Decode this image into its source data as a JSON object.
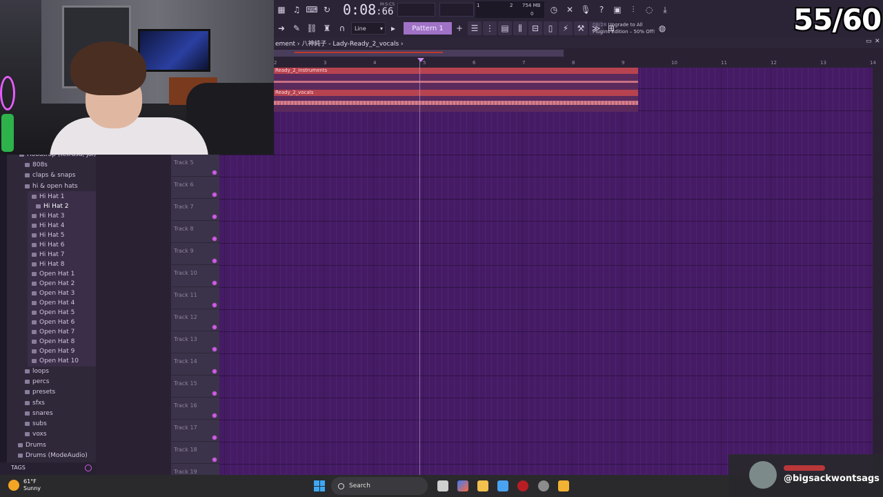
{
  "counter": "55/60",
  "toolbar": {
    "time": "0:08",
    "time_small": "66",
    "time_unit": "M:S:CS",
    "cpu_a": "1",
    "cpu_b": "2",
    "mem": "754 MB",
    "cpu_c": "0",
    "line_mode": "Line",
    "pattern": "Pattern 1",
    "upgrade_counter": "08/28",
    "upgrade_line1": "Upgrade to All",
    "upgrade_line2": "Plugins Edition – 50% Off!"
  },
  "playlist": {
    "title": "ement › 八神純子 - Lady-Ready_2_vocals ›",
    "ruler": [
      "2",
      "3",
      "4",
      "5",
      "6",
      "7",
      "8",
      "9",
      "10",
      "11",
      "12",
      "13",
      "14"
    ],
    "clips": [
      {
        "label": "Ready_2_instruments"
      },
      {
        "label": "Ready_2_vocals"
      }
    ],
    "tracks": [
      "Track 5",
      "Track 6",
      "Track 7",
      "Track 8",
      "Track 9",
      "Track 10",
      "Track 11",
      "Track 12",
      "Track 13",
      "Track 14",
      "Track 15",
      "Track 16",
      "Track 17",
      "Track 18",
      "Track 19"
    ]
  },
  "browser": {
    "root": "Hoodtrap (tetrasu, jai)",
    "items": [
      "808s",
      "claps & snaps",
      "hi & open hats",
      "Hi Hat 1",
      "Hi Hat 2",
      "Hi Hat 3",
      "Hi Hat 4",
      "Hi Hat 5",
      "Hi Hat 6",
      "Hi Hat 7",
      "Hi Hat 8",
      "Open Hat 1",
      "Open Hat 2",
      "Open Hat 3",
      "Open Hat 4",
      "Open Hat 5",
      "Open Hat 6",
      "Open Hat 7",
      "Open Hat 8",
      "Open Hat 9",
      "Open Hat 10",
      "loops",
      "percs",
      "presets",
      "sfxs",
      "snares",
      "subs",
      "voxs",
      "Drums",
      "Drums (ModeAudio)"
    ],
    "tags_label": "TAGS"
  },
  "taskbar": {
    "temp": "61°F",
    "weather": "Sunny",
    "search": "Search"
  },
  "badge": {
    "handle": "@bigsackwontsags"
  },
  "colors": {
    "grid": "#461b66",
    "clip_header": "#b6434f",
    "pattern": "#a072c6",
    "accent": "#d05ae6"
  }
}
